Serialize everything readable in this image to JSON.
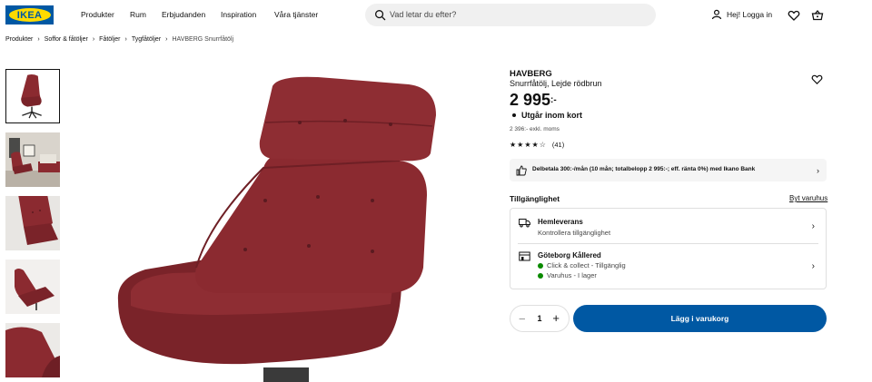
{
  "brand": {
    "logo_text": "IKEA"
  },
  "nav": [
    "Produkter",
    "Rum",
    "Erbjudanden",
    "Inspiration",
    "Våra tjänster"
  ],
  "search": {
    "placeholder": "Vad letar du efter?",
    "icon": "search-icon"
  },
  "header": {
    "login_label": "Hej! Logga in",
    "icons": [
      "person-icon",
      "heart-icon",
      "cart-icon"
    ]
  },
  "breadcrumb": [
    "Produkter",
    "Soffor & fåtöljer",
    "Fåtöljer",
    "Tygfåtöljer",
    "HAVBERG Snurrfåtölj"
  ],
  "product": {
    "name": "HAVBERG",
    "description": "Snurrfåtölj, Lejde rödbrun",
    "price": "2 995",
    "price_suffix": ":-",
    "stock_status": "Utgår inom kort",
    "price_exkl": "2 396:- exkl. moms",
    "rating_stars": 4.5,
    "review_count": "(41)"
  },
  "finance": {
    "text": "Delbetala 300:-/mån (10 mån; totalbelopp 2 995:-; eff. ränta 0%) med Ikano Bank"
  },
  "availability": {
    "title": "Tillgänglighet",
    "change_store_label": "Byt varuhus",
    "delivery": {
      "title": "Hemleverans",
      "subtitle": "Kontrollera tillgänglighet"
    },
    "store": {
      "title": "Göteborg Kållered",
      "click_collect": "Click & collect - Tillgänglig",
      "in_store": "Varuhus - I lager"
    }
  },
  "cart": {
    "quantity": "1",
    "add_label": "Lägg i varukorg"
  },
  "colors": {
    "ikea_blue": "#0058a3",
    "ikea_yellow": "#ffdb00",
    "chair_red": "#8b2a30",
    "stock_green": "#0a8a00"
  }
}
